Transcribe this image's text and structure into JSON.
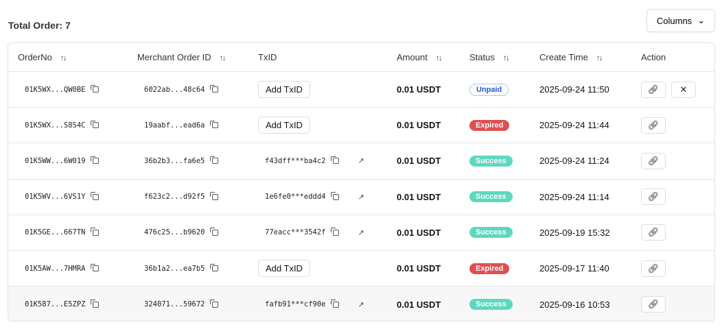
{
  "total_label": "Total Order: 7",
  "columns_button": "Columns",
  "headers": {
    "order_no": "OrderNo",
    "merchant": "Merchant Order ID",
    "txid": "TxID",
    "amount": "Amount",
    "status": "Status",
    "create_time": "Create Time",
    "action": "Action"
  },
  "add_txid_label": "Add TxID",
  "rows": [
    {
      "order": "01K5WX...QW0BE",
      "merchant": "6022ab...48c64",
      "txid": null,
      "amount": "0.01 USDT",
      "status": "Unpaid",
      "time": "2025-09-24 11:50",
      "cancel": true
    },
    {
      "order": "01K5WX...S8S4C",
      "merchant": "19aabf...ead6a",
      "txid": null,
      "amount": "0.01 USDT",
      "status": "Expired",
      "time": "2025-09-24 11:44",
      "cancel": false
    },
    {
      "order": "01K5WW...6W019",
      "merchant": "36b2b3...fa6e5",
      "txid": "f43dff***ba4c2",
      "amount": "0.01 USDT",
      "status": "Success",
      "time": "2025-09-24 11:24",
      "cancel": false
    },
    {
      "order": "01K5WV...6VS1Y",
      "merchant": "f623c2...d92f5",
      "txid": "1e6fe0***eddd4",
      "amount": "0.01 USDT",
      "status": "Success",
      "time": "2025-09-24 11:14",
      "cancel": false
    },
    {
      "order": "01K5GE...667TN",
      "merchant": "476c25...b9620",
      "txid": "77eacc***3542f",
      "amount": "0.01 USDT",
      "status": "Success",
      "time": "2025-09-19 15:32",
      "cancel": false
    },
    {
      "order": "01K5AW...7HMRA",
      "merchant": "36b1a2...ea7b5",
      "txid": null,
      "amount": "0.01 USDT",
      "status": "Expired",
      "time": "2025-09-17 11:40",
      "cancel": false
    },
    {
      "order": "01K587...E5ZPZ",
      "merchant": "324071...59672",
      "txid": "fafb91***cf90e",
      "amount": "0.01 USDT",
      "status": "Success",
      "time": "2025-09-16 10:53",
      "cancel": false
    }
  ]
}
